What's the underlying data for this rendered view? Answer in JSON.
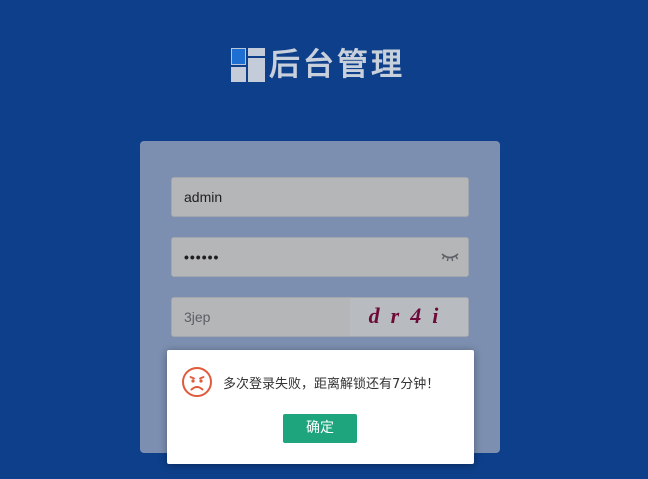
{
  "header": {
    "logo_text": "后台管理"
  },
  "login_form": {
    "username_value": "admin",
    "password_value": "••••••",
    "captcha_input_value": "3jep",
    "captcha_image_text": "dr4i"
  },
  "dialog": {
    "message": "多次登录失败，距离解锁还有7分钟！",
    "confirm_label": "确定",
    "icon": "sad-face-icon",
    "icon_color": "#e05a3b",
    "button_color": "#1fa57d"
  },
  "colors": {
    "background": "#0e3f8a",
    "panel": "#7c8fb0",
    "captcha_text": "#6e0a3a"
  }
}
